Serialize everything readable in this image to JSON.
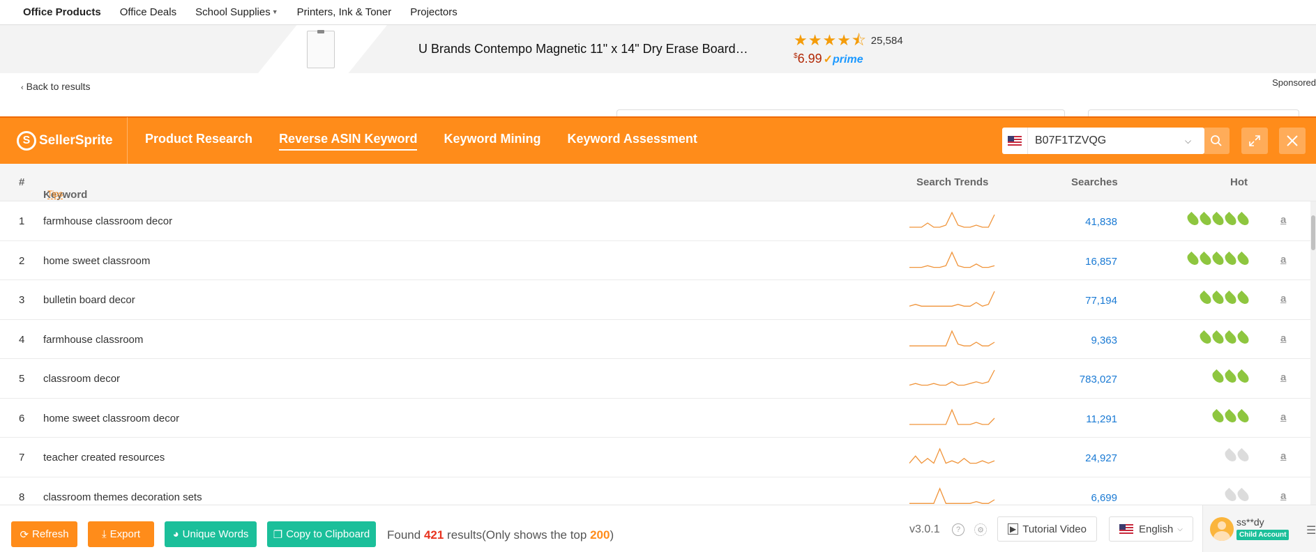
{
  "amazon_nav": {
    "items": [
      "Office Products",
      "Office Deals",
      "School Supplies",
      "Printers, Ink & Toner",
      "Projectors"
    ]
  },
  "sponsored_product": {
    "title": "U Brands Contempo Magnetic 11\" x 14\" Dry Erase Board…",
    "rating": 4.5,
    "review_count": "25,584",
    "price_symbol": "$",
    "price": "6.99",
    "prime_label": "prime"
  },
  "back_to_results": "Back to results",
  "sponsored_label": "Sponsored",
  "sellersprite": {
    "logo_text": "SellerSprite",
    "tabs": [
      "Product Research",
      "Reverse ASIN Keyword",
      "Keyword Mining",
      "Keyword Assessment"
    ],
    "active_tab": "Reverse ASIN Keyword",
    "asin_value": "B07F1TZVQG",
    "accent_color": "#ff8c1a"
  },
  "table": {
    "headers": {
      "num": "#",
      "keyword": "Keyword",
      "tips": "Tips",
      "trends": "Search Trends",
      "searches": "Searches",
      "hot": "Hot"
    },
    "rows": [
      {
        "num": "1",
        "keyword": "farmhouse classroom decor",
        "searches": "41,838",
        "hot": 5,
        "hot_color": "green",
        "trend": [
          1,
          1,
          1,
          3,
          1,
          1,
          2,
          8,
          2,
          1,
          1,
          2,
          1,
          1,
          7
        ]
      },
      {
        "num": "2",
        "keyword": "home sweet classroom",
        "searches": "16,857",
        "hot": 5,
        "hot_color": "green",
        "trend": [
          1,
          1,
          1,
          2,
          1,
          1,
          2,
          10,
          2,
          1,
          1,
          3,
          1,
          1,
          2
        ]
      },
      {
        "num": "3",
        "keyword": "bulletin board decor",
        "searches": "77,194",
        "hot": 4,
        "hot_color": "green",
        "trend": [
          1,
          2,
          1,
          1,
          1,
          1,
          1,
          1,
          2,
          1,
          1,
          3,
          1,
          2,
          9
        ]
      },
      {
        "num": "4",
        "keyword": "farmhouse classroom",
        "searches": "9,363",
        "hot": 4,
        "hot_color": "green",
        "trend": [
          1,
          1,
          1,
          1,
          1,
          1,
          1,
          9,
          2,
          1,
          1,
          3,
          1,
          1,
          3
        ]
      },
      {
        "num": "5",
        "keyword": "classroom decor",
        "searches": "783,027",
        "hot": 3,
        "hot_color": "green",
        "trend": [
          1,
          2,
          1,
          1,
          2,
          1,
          1,
          3,
          1,
          1,
          2,
          3,
          2,
          3,
          10
        ]
      },
      {
        "num": "6",
        "keyword": "home sweet classroom decor",
        "searches": "11,291",
        "hot": 3,
        "hot_color": "green",
        "trend": [
          1,
          1,
          1,
          1,
          1,
          1,
          1,
          8,
          1,
          1,
          1,
          2,
          1,
          1,
          4
        ]
      },
      {
        "num": "7",
        "keyword": "teacher created resources",
        "searches": "24,927",
        "hot": 2,
        "hot_color": "gray",
        "trend": [
          1,
          4,
          1,
          3,
          1,
          7,
          1,
          2,
          1,
          3,
          1,
          1,
          2,
          1,
          2
        ]
      },
      {
        "num": "8",
        "keyword": "classroom themes decoration sets",
        "searches": "6,699",
        "hot": 2,
        "hot_color": "gray",
        "trend": [
          1,
          1,
          1,
          1,
          1,
          9,
          1,
          1,
          1,
          1,
          1,
          2,
          1,
          1,
          3
        ]
      }
    ]
  },
  "footer": {
    "refresh": "Refresh",
    "export": "Export",
    "unique_words": "Unique Words",
    "copy": "Copy to Clipboard",
    "found_prefix": "Found ",
    "found_count": "421",
    "found_middle": " results(Only shows the top ",
    "found_top": "200",
    "found_suffix": ")",
    "version": "v3.0.1",
    "tutorial": "Tutorial Video",
    "language": "English",
    "username": "ss**dy",
    "account_badge": "Child Account"
  }
}
